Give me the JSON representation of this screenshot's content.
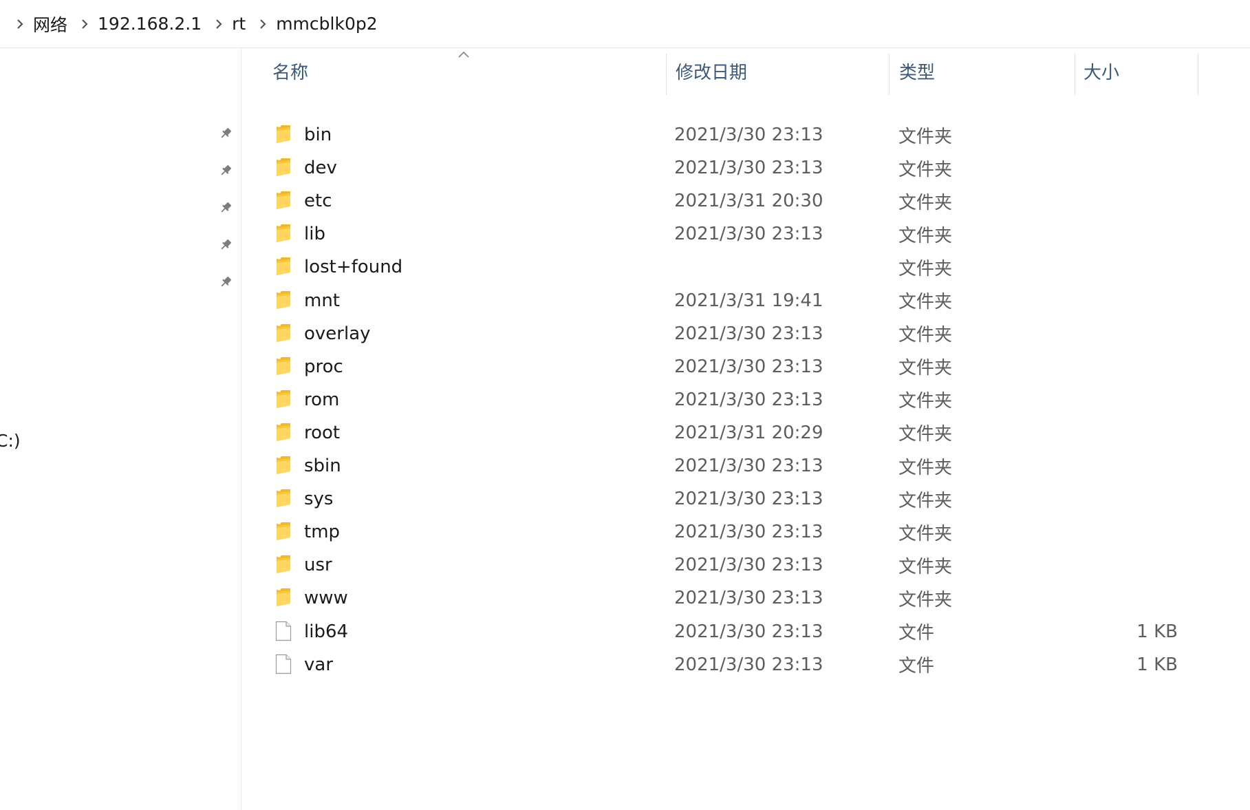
{
  "breadcrumb": {
    "items": [
      "网络",
      "192.168.2.1",
      "rt",
      "mmcblk0p2"
    ]
  },
  "nav": {
    "pinned_count": 5,
    "partial_label": "C:)"
  },
  "columns": {
    "name": "名称",
    "modified": "修改日期",
    "type": "类型",
    "size": "大小",
    "sorted_by": "name",
    "sort_direction": "ascending"
  },
  "files": [
    {
      "name": "bin",
      "date": "2021/3/30 23:13",
      "type": "文件夹",
      "size": "",
      "icon": "folder-icon"
    },
    {
      "name": "dev",
      "date": "2021/3/30 23:13",
      "type": "文件夹",
      "size": "",
      "icon": "folder-icon"
    },
    {
      "name": "etc",
      "date": "2021/3/31 20:30",
      "type": "文件夹",
      "size": "",
      "icon": "folder-icon"
    },
    {
      "name": "lib",
      "date": "2021/3/30 23:13",
      "type": "文件夹",
      "size": "",
      "icon": "folder-icon"
    },
    {
      "name": "lost+found",
      "date": "",
      "type": "文件夹",
      "size": "",
      "icon": "folder-icon"
    },
    {
      "name": "mnt",
      "date": "2021/3/31 19:41",
      "type": "文件夹",
      "size": "",
      "icon": "folder-icon"
    },
    {
      "name": "overlay",
      "date": "2021/3/30 23:13",
      "type": "文件夹",
      "size": "",
      "icon": "folder-icon"
    },
    {
      "name": "proc",
      "date": "2021/3/30 23:13",
      "type": "文件夹",
      "size": "",
      "icon": "folder-icon"
    },
    {
      "name": "rom",
      "date": "2021/3/30 23:13",
      "type": "文件夹",
      "size": "",
      "icon": "folder-icon"
    },
    {
      "name": "root",
      "date": "2021/3/31 20:29",
      "type": "文件夹",
      "size": "",
      "icon": "folder-icon"
    },
    {
      "name": "sbin",
      "date": "2021/3/30 23:13",
      "type": "文件夹",
      "size": "",
      "icon": "folder-icon"
    },
    {
      "name": "sys",
      "date": "2021/3/30 23:13",
      "type": "文件夹",
      "size": "",
      "icon": "folder-icon"
    },
    {
      "name": "tmp",
      "date": "2021/3/30 23:13",
      "type": "文件夹",
      "size": "",
      "icon": "folder-icon"
    },
    {
      "name": "usr",
      "date": "2021/3/30 23:13",
      "type": "文件夹",
      "size": "",
      "icon": "folder-icon"
    },
    {
      "name": "www",
      "date": "2021/3/30 23:13",
      "type": "文件夹",
      "size": "",
      "icon": "folder-icon"
    },
    {
      "name": "lib64",
      "date": "2021/3/30 23:13",
      "type": "文件",
      "size": "1 KB",
      "icon": "file-icon"
    },
    {
      "name": "var",
      "date": "2021/3/30 23:13",
      "type": "文件",
      "size": "1 KB",
      "icon": "file-icon"
    }
  ],
  "colors": {
    "header_text": "#3c5a78",
    "folder_yellow": "#f8c93e",
    "secondary_text": "#5d5d5d"
  }
}
